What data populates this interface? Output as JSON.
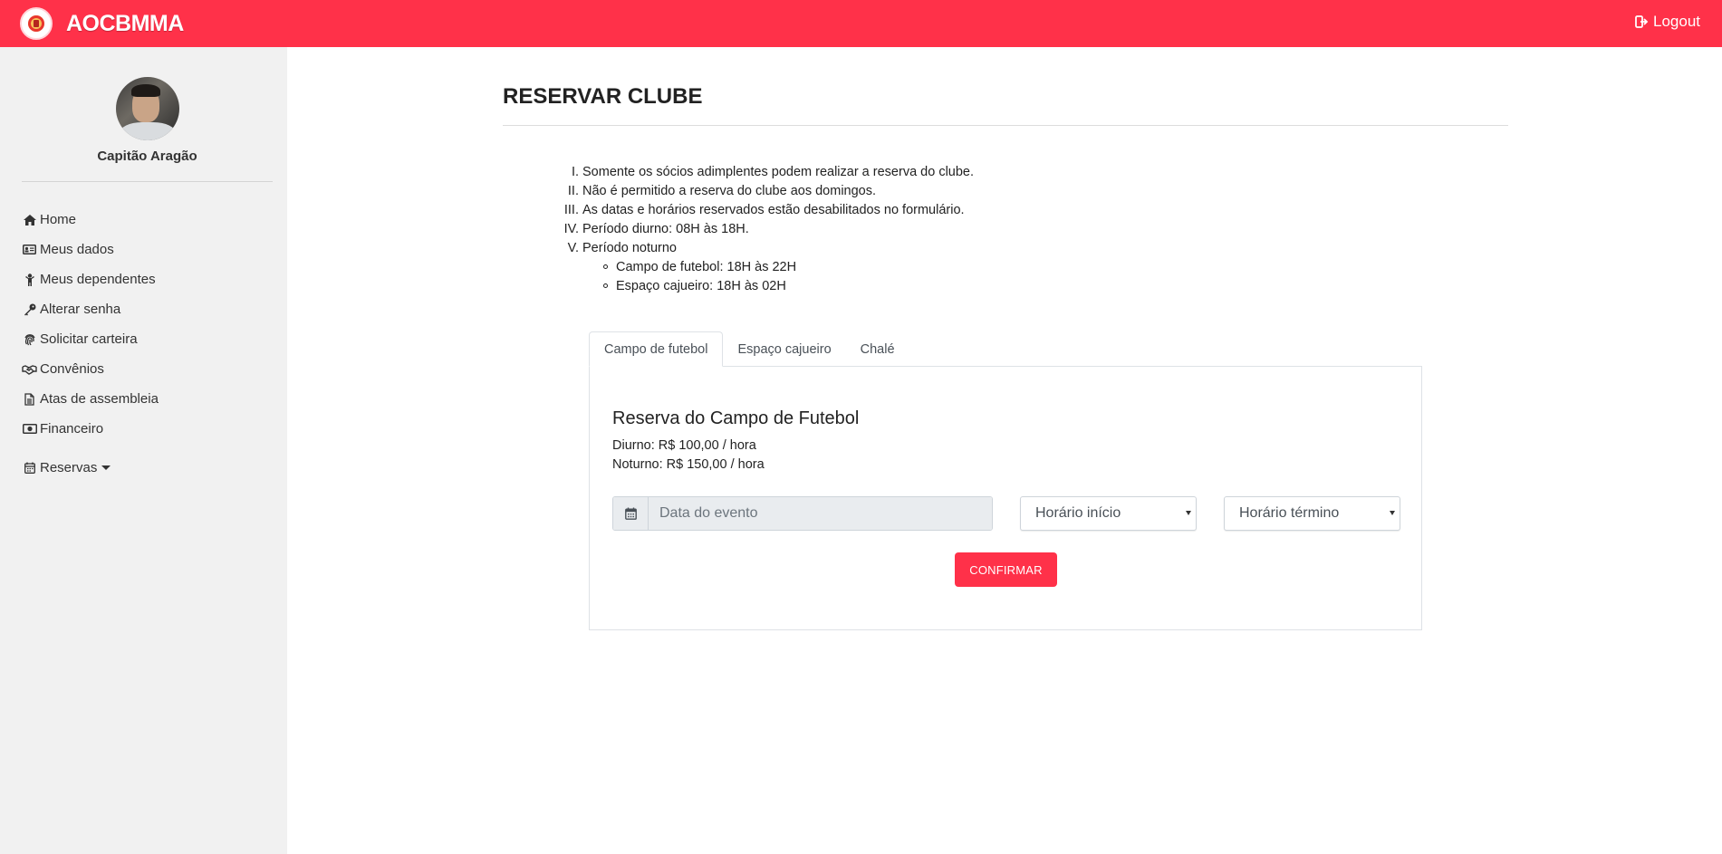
{
  "header": {
    "brand": "AOCBMMA",
    "logo_icon": "club-emblem-icon",
    "logout_label": "Logout",
    "logout_icon": "sign-out-icon",
    "color": "#ff3149"
  },
  "sidebar": {
    "user_name": "Capitão Aragão",
    "items": [
      {
        "label": "Home",
        "icon": "home-icon"
      },
      {
        "label": "Meus dados",
        "icon": "id-card-icon"
      },
      {
        "label": "Meus dependentes",
        "icon": "child-icon"
      },
      {
        "label": "Alterar senha",
        "icon": "key-icon"
      },
      {
        "label": "Solicitar carteira",
        "icon": "fingerprint-icon"
      },
      {
        "label": "Convênios",
        "icon": "handshake-icon"
      },
      {
        "label": "Atas de assembleia",
        "icon": "document-icon"
      },
      {
        "label": "Financeiro",
        "icon": "money-bill-icon"
      },
      {
        "label": "Reservas",
        "icon": "calendar-icon"
      }
    ]
  },
  "main": {
    "title": "RESERVAR CLUBE",
    "rules": [
      {
        "num": "I.",
        "text": "Somente os sócios adimplentes podem realizar a reserva do clube."
      },
      {
        "num": "II.",
        "text": "Não é permitido a reserva do clube aos domingos."
      },
      {
        "num": "III.",
        "text": "As datas e horários reservados estão desabilitados no formulário."
      },
      {
        "num": "IV.",
        "text": "Período diurno: 08H às 18H."
      },
      {
        "num": "V.",
        "text": "Período noturno"
      }
    ],
    "sub_rules": [
      "Campo de futebol: 18H às 22H",
      "Espaço cajueiro: 18H às 02H"
    ],
    "tabs": [
      {
        "label": "Campo de futebol",
        "active": true
      },
      {
        "label": "Espaço cajueiro",
        "active": false
      },
      {
        "label": "Chalé",
        "active": false
      }
    ],
    "panel": {
      "title": "Reserva do Campo de Futebol",
      "price_day": "Diurno: R$ 100,00 / hora",
      "price_night": "Noturno: R$ 150,00 / hora",
      "date_placeholder": "Data do evento",
      "start_select": "Horário início",
      "end_select": "Horário término",
      "confirm_label": "CONFIRMAR"
    }
  }
}
